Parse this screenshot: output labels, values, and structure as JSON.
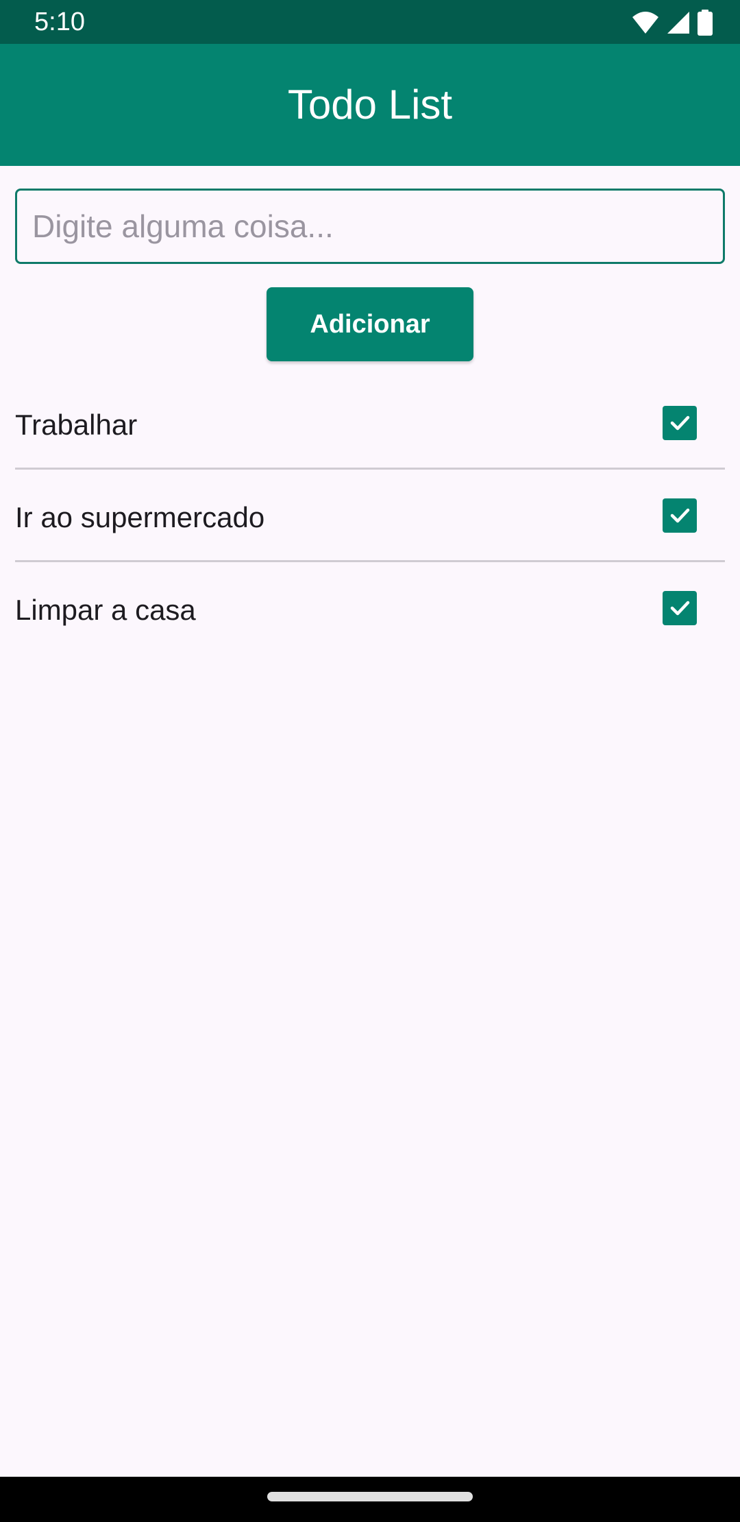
{
  "status_bar": {
    "time": "5:10",
    "icons": [
      "wifi-icon",
      "signal-icon",
      "battery-icon"
    ]
  },
  "app_bar": {
    "title": "Todo List"
  },
  "input": {
    "placeholder": "Digite alguma coisa...",
    "value": ""
  },
  "add_button": {
    "label": "Adicionar"
  },
  "todos": [
    {
      "label": "Trabalhar",
      "checked": true
    },
    {
      "label": "Ir ao supermercado",
      "checked": true
    },
    {
      "label": "Limpar a casa",
      "checked": true
    }
  ],
  "colors": {
    "primary": "#048470",
    "status_bar": "#035c4d",
    "background": "#fcf7fd",
    "divider": "#cfcbd2"
  }
}
